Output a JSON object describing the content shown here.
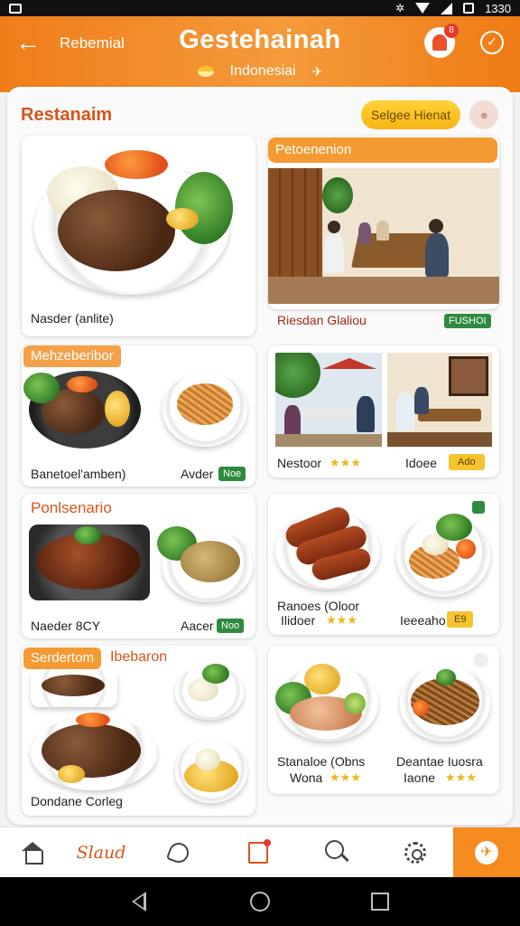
{
  "status_bar": {
    "time": "1330"
  },
  "header": {
    "back_label": "Rebemial",
    "title": "Gestehainah",
    "subtitle": "Indonesiai",
    "notification_count": "8"
  },
  "panel": {
    "title": "Restanaim",
    "select_button": "Selgee Hienat",
    "filter_button": "ၜ"
  },
  "cards": {
    "c1": {
      "label": "Nasder (anlite)"
    },
    "c2": {
      "tag": "Petoenenion",
      "label": "Riesdan Glaliou",
      "badge": "FUSHOI"
    },
    "c3": {
      "tag": "Mehzeberibor",
      "left_label": "Banetoel'amben)",
      "right_label": "Avder",
      "badge": "Noe"
    },
    "c4": {
      "left_label": "Nestoor",
      "left_stars": "★★★",
      "right_label": "Idoee",
      "badge": "Ado"
    },
    "c5": {
      "heading": "Ponlsenario",
      "left_label": "Naeder 8CY",
      "right_label": "Aacer",
      "badge": "Noo"
    },
    "c6": {
      "left_label_1": "Ranoes (Oloor",
      "left_label_2": "Ilidoer",
      "left_stars": "★★★",
      "right_label": "Ieeeaho",
      "badge": "E9"
    },
    "c7": {
      "tag": "Serdertom",
      "heading": "Ibebaron",
      "label": "Dondane Corleg"
    },
    "c8": {
      "left_label_1": "Stanaloe (Obns",
      "left_label_2": "Wona",
      "left_stars": "★★★",
      "right_label_1": "Deantae Iuosra",
      "right_label_2": "Iaone",
      "right_stars": "★★★"
    }
  },
  "bottom_nav": {
    "text_item": "Slaud"
  },
  "colors": {
    "brand_orange": "#f07d1a",
    "accent_red": "#d8541b",
    "badge_green": "#2e8b3e",
    "badge_gold": "#f6c42f"
  }
}
